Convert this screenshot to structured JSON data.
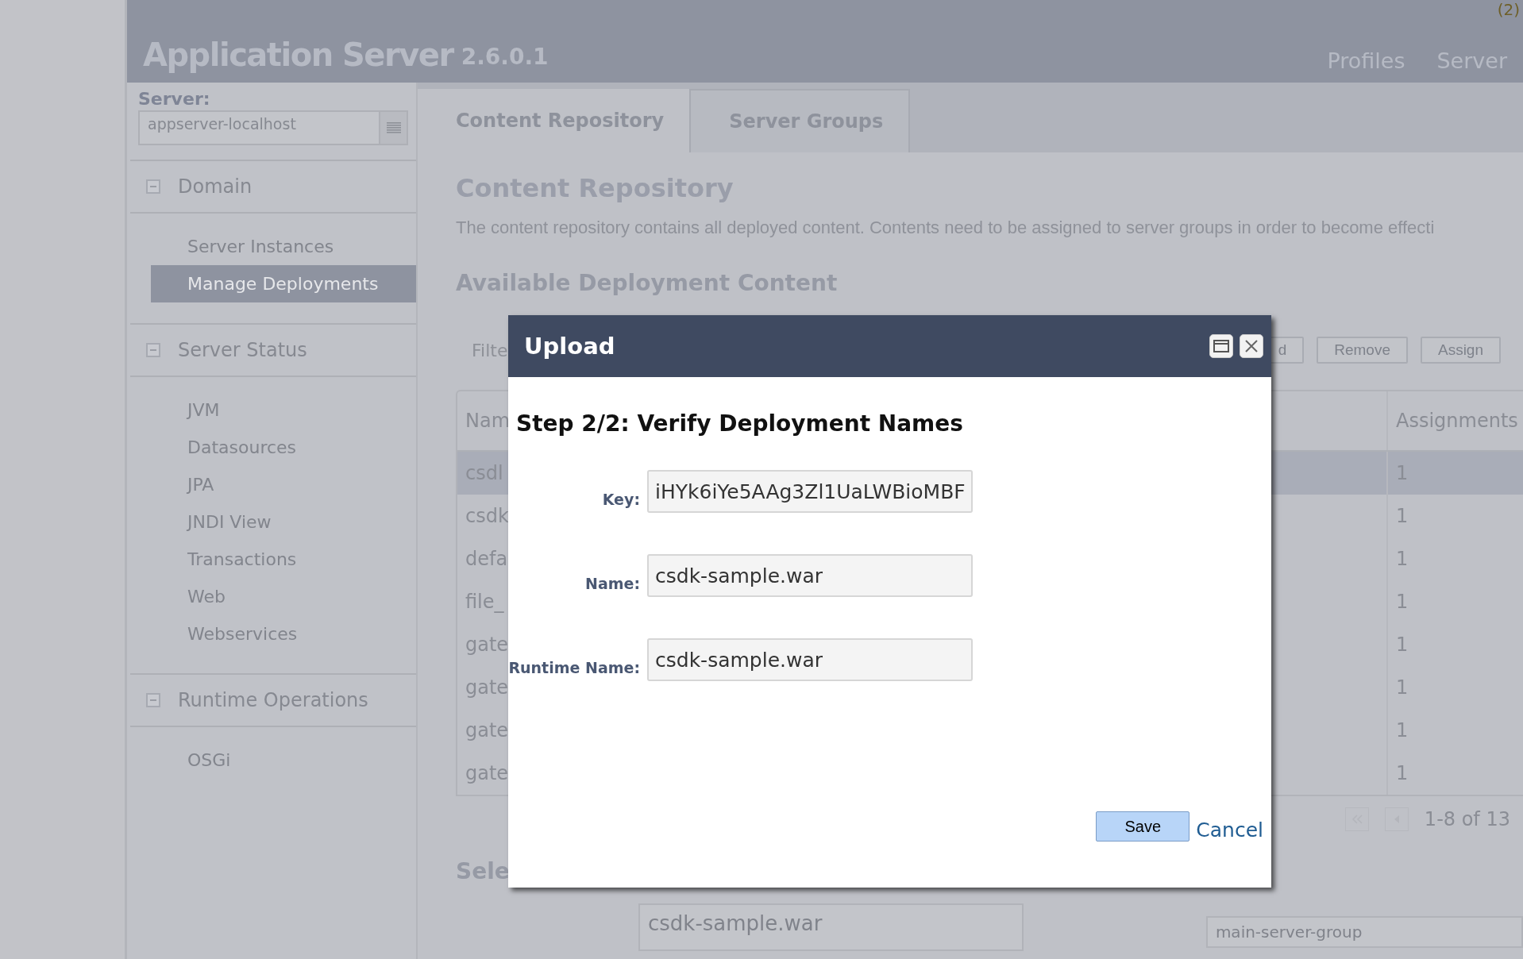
{
  "header": {
    "title": "Application Server",
    "version": "2.6.0.1",
    "badge": "(2)",
    "nav": [
      {
        "label": "Profiles"
      },
      {
        "label": "Server"
      }
    ]
  },
  "sidebar": {
    "server_label": "Server:",
    "server_value": "appserver-localhost",
    "sections": [
      {
        "title": "Domain",
        "expanded": true,
        "items": [
          {
            "label": "Server Instances",
            "selected": false
          },
          {
            "label": "Manage Deployments",
            "selected": true
          }
        ]
      },
      {
        "title": "Server Status",
        "expanded": true,
        "items": [
          {
            "label": "JVM",
            "selected": false
          },
          {
            "label": "Datasources",
            "selected": false
          },
          {
            "label": "JPA",
            "selected": false
          },
          {
            "label": "JNDI View",
            "selected": false
          },
          {
            "label": "Transactions",
            "selected": false
          },
          {
            "label": "Web",
            "selected": false
          },
          {
            "label": "Webservices",
            "selected": false
          }
        ]
      },
      {
        "title": "Runtime Operations",
        "expanded": true,
        "items": [
          {
            "label": "OSGi",
            "selected": false
          }
        ]
      }
    ]
  },
  "tabs": [
    {
      "label": "Content Repository",
      "selected": true
    },
    {
      "label": "Server Groups",
      "selected": false
    }
  ],
  "content": {
    "title": "Content Repository",
    "description": "The content repository contains all deployed content. Contents need to be assigned to server groups in order to become effecti",
    "section_title": "Available Deployment Content",
    "filter_label": "Filte",
    "buttons": [
      "d",
      "Remove",
      "Assign"
    ],
    "table": {
      "columns": [
        "Nam",
        "Assignments"
      ],
      "rows": [
        {
          "name": "csdl",
          "assignments": "1",
          "selected": true
        },
        {
          "name": "csdk",
          "assignments": "1",
          "selected": false
        },
        {
          "name": "defa",
          "assignments": "1",
          "selected": false
        },
        {
          "name": "file_",
          "assignments": "1",
          "selected": false
        },
        {
          "name": "gate",
          "assignments": "1",
          "selected": false
        },
        {
          "name": "gate",
          "assignments": "1",
          "selected": false
        },
        {
          "name": "gate",
          "assignments": "1",
          "selected": false
        },
        {
          "name": "gate",
          "assignments": "1",
          "selected": false
        }
      ]
    },
    "pager": "1-8 of 13",
    "selection_title": "Sele",
    "selection_name": "csdk-sample.war",
    "server_group": "main-server-group"
  },
  "dialog": {
    "title": "Upload",
    "step": "Step 2/2: Verify Deployment Names",
    "fields": [
      {
        "label": "Key:",
        "value": "iHYk6iYe5AAg3Zl1UaLWBioMBF"
      },
      {
        "label": "Name:",
        "value": "csdk-sample.war"
      },
      {
        "label": "Runtime Name:",
        "value": "csdk-sample.war"
      }
    ],
    "save": "Save",
    "cancel": "Cancel"
  }
}
